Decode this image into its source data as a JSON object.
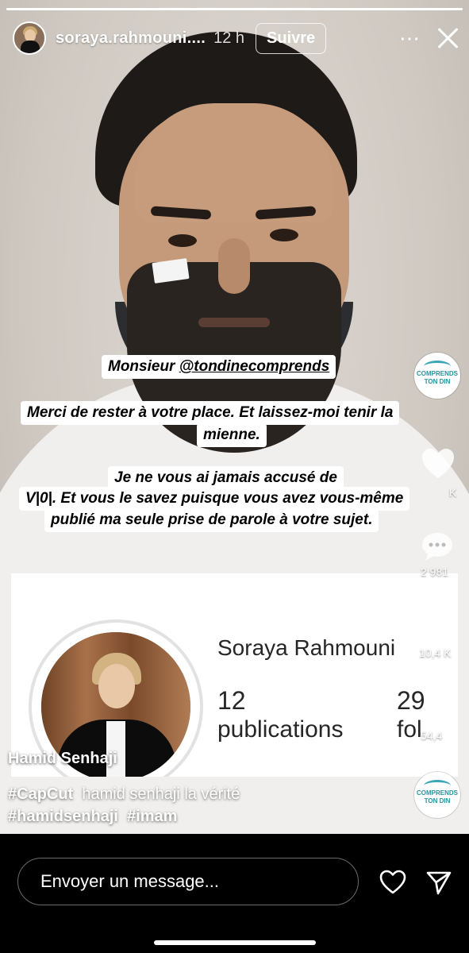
{
  "story": {
    "progress": 1.0,
    "username": "soraya.rahmouni....",
    "time_ago": "12 h",
    "follow_label": "Suivre",
    "more_icon": "⋯"
  },
  "captions": {
    "line1_prefix": "Monsieur ",
    "line1_mention": "@tondinecomprends",
    "line2": "Merci de rester à votre place. Et laissez-moi tenir la",
    "line3": "mienne.",
    "line4": "Je ne vous ai jamais accusé de",
    "line5": "V|0|. Et vous le savez puisque vous avez vous-même",
    "line6": "publié ma seule prise de parole à votre sujet."
  },
  "profile_card": {
    "name": "Soraya Rahmouni",
    "posts_count": "12",
    "posts_label": "publications",
    "followers_count": "29",
    "followers_label": "fol"
  },
  "overlay": {
    "creator_label": "Hamid Senhaji",
    "tag1": "#CapCut",
    "tag1_text": "hamid senhaji la vérité",
    "tag2": "#hamidsenhaji",
    "tag3": "#imam"
  },
  "side": {
    "like_count_partial": "K",
    "comment_count": "2 981",
    "save_count": "10,4 K",
    "share_count": "54,4"
  },
  "logo": {
    "line1": "COMPRENDS",
    "line2": "TON DIN"
  },
  "reply": {
    "placeholder": "Envoyer un message..."
  }
}
